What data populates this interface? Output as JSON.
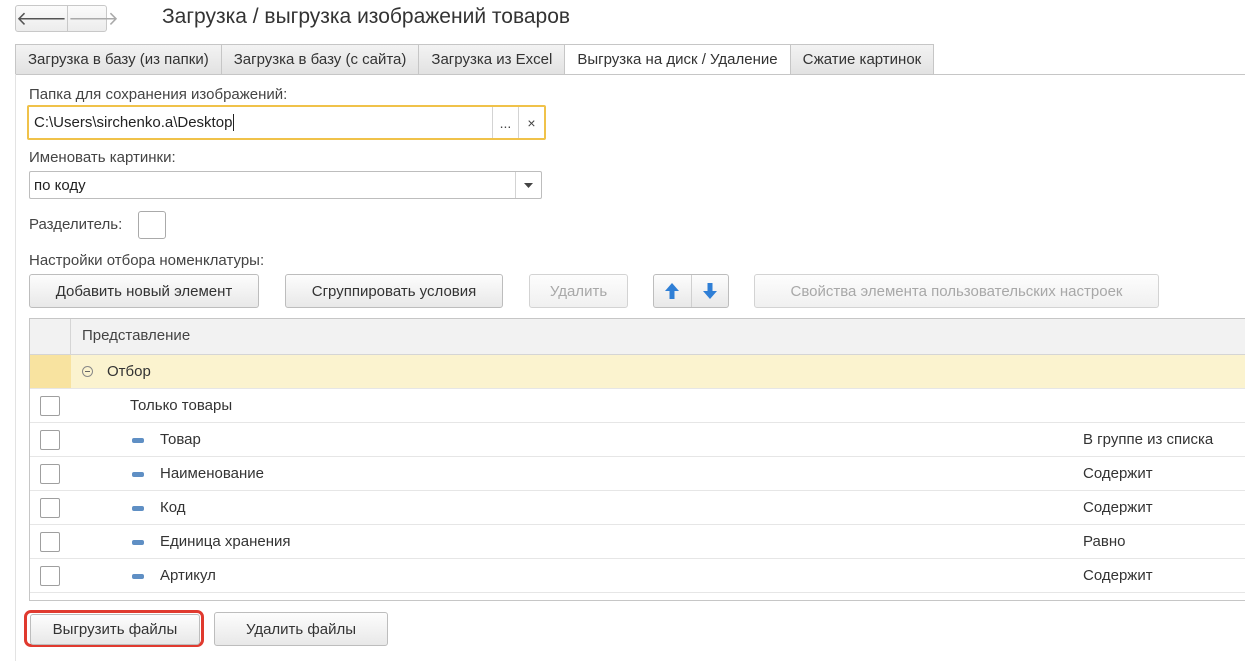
{
  "nav": {
    "back_glyph": "🡐",
    "forward_glyph": "🡒",
    "back_icon": "arrow-left-icon",
    "forward_icon": "arrow-right-icon"
  },
  "window": {
    "title": "Загрузка / выгрузка изображений товаров"
  },
  "tabs": [
    {
      "label": "Загрузка в базу (из папки)",
      "active": false
    },
    {
      "label": "Загрузка в базу (с сайта)",
      "active": false
    },
    {
      "label": "Загрузка из Excel",
      "active": false
    },
    {
      "label": "Выгрузка на диск / Удаление",
      "active": true
    },
    {
      "label": "Сжатие картинок",
      "active": false
    }
  ],
  "folder": {
    "label": "Папка для сохранения изображений:",
    "value": "C:\\Users\\sirchenko.a\\Desktop",
    "choose_label": "...",
    "clear_label": "×"
  },
  "naming": {
    "label": "Именовать картинки:",
    "value": "по коду"
  },
  "separator": {
    "label": "Разделитель:"
  },
  "filter": {
    "label": "Настройки отбора номенклатуры:",
    "buttons": {
      "add": "Добавить новый элемент",
      "group": "Сгруппировать условия",
      "delete": "Удалить",
      "properties": "Свойства элемента пользовательских настроек"
    },
    "table": {
      "header": "Представление",
      "group_row": "Отбор",
      "rows": [
        {
          "name": "Только товары",
          "condition": ""
        },
        {
          "name": "Товар",
          "condition": "В группе из списка"
        },
        {
          "name": "Наименование",
          "condition": "Содержит"
        },
        {
          "name": "Код",
          "condition": "Содержит"
        },
        {
          "name": "Единица хранения",
          "condition": "Равно"
        },
        {
          "name": "Артикул",
          "condition": "Содержит"
        }
      ]
    }
  },
  "actions": {
    "export": "Выгрузить файлы",
    "delete": "Удалить файлы"
  },
  "colors": {
    "focus": "#f0c24a",
    "group_row": "#fbf3cf",
    "highlight": "#e03a2f",
    "arrow": "#2f7fd6"
  }
}
